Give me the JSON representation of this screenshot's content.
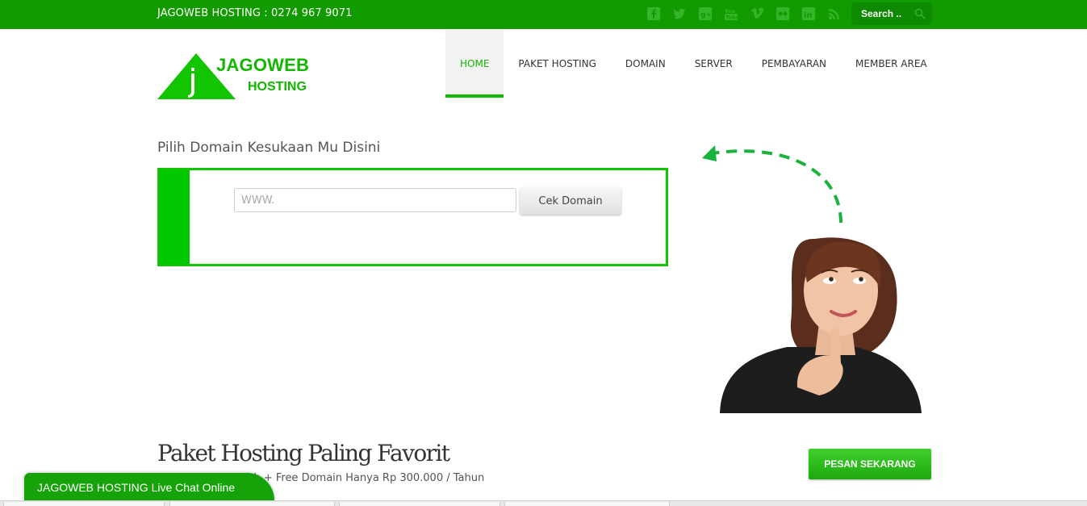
{
  "topbar": {
    "contact": "JAGOWEB HOSTING : 0274 967 9071",
    "social_icons": [
      "facebook-icon",
      "twitter-icon",
      "google-plus-icon",
      "youtube-icon",
      "vimeo-icon",
      "flickr-icon",
      "linkedin-icon",
      "rss-icon"
    ],
    "search_placeholder": "Search .."
  },
  "logo": {
    "line1": "JAGOWEB",
    "line2": "HOSTING",
    "letter": "j"
  },
  "nav": {
    "items": [
      "HOME",
      "PAKET HOSTING",
      "DOMAIN",
      "SERVER",
      "PEMBAYARAN",
      "MEMBER AREA"
    ],
    "active": "HOME"
  },
  "domain": {
    "title": "Pilih Domain Kesukaan Mu Disini",
    "input_placeholder": "WWW.",
    "button_label": "Cek Domain"
  },
  "paket": {
    "title": "Paket Hosting Paling Favorit",
    "subtitle": "Unlimited Bandwith + Free Domain Hanya Rp 300.000 / Tahun",
    "button_label": "PESAN SEKARANG"
  },
  "livechat": {
    "label": "JAGOWEB HOSTING Live Chat Online"
  },
  "colors": {
    "brand_green": "#13b600",
    "topbar_green": "#129b00"
  }
}
